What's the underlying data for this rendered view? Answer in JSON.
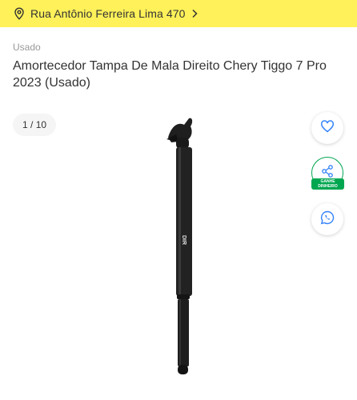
{
  "address": {
    "text": "Rua Antônio Ferreira Lima 470",
    "icon": "location-pin-icon",
    "bar_color": "#fff159"
  },
  "product": {
    "condition": "Usado",
    "title": "Amortecedor Tampa De Mala Direito Chery Tiggo 7 Pro 2023 (Usado)"
  },
  "gallery": {
    "current": "1",
    "separator": " / ",
    "total": "10",
    "image_label": "DIR"
  },
  "actions": {
    "favorite_icon": "heart-icon",
    "share_icon": "share-icon",
    "earn_badge_line1": "GANHE",
    "earn_badge_line2": "DINHEIRO",
    "whatsapp_icon": "whatsapp-icon",
    "accent_color": "#3483fa",
    "earn_color": "#00a650"
  }
}
